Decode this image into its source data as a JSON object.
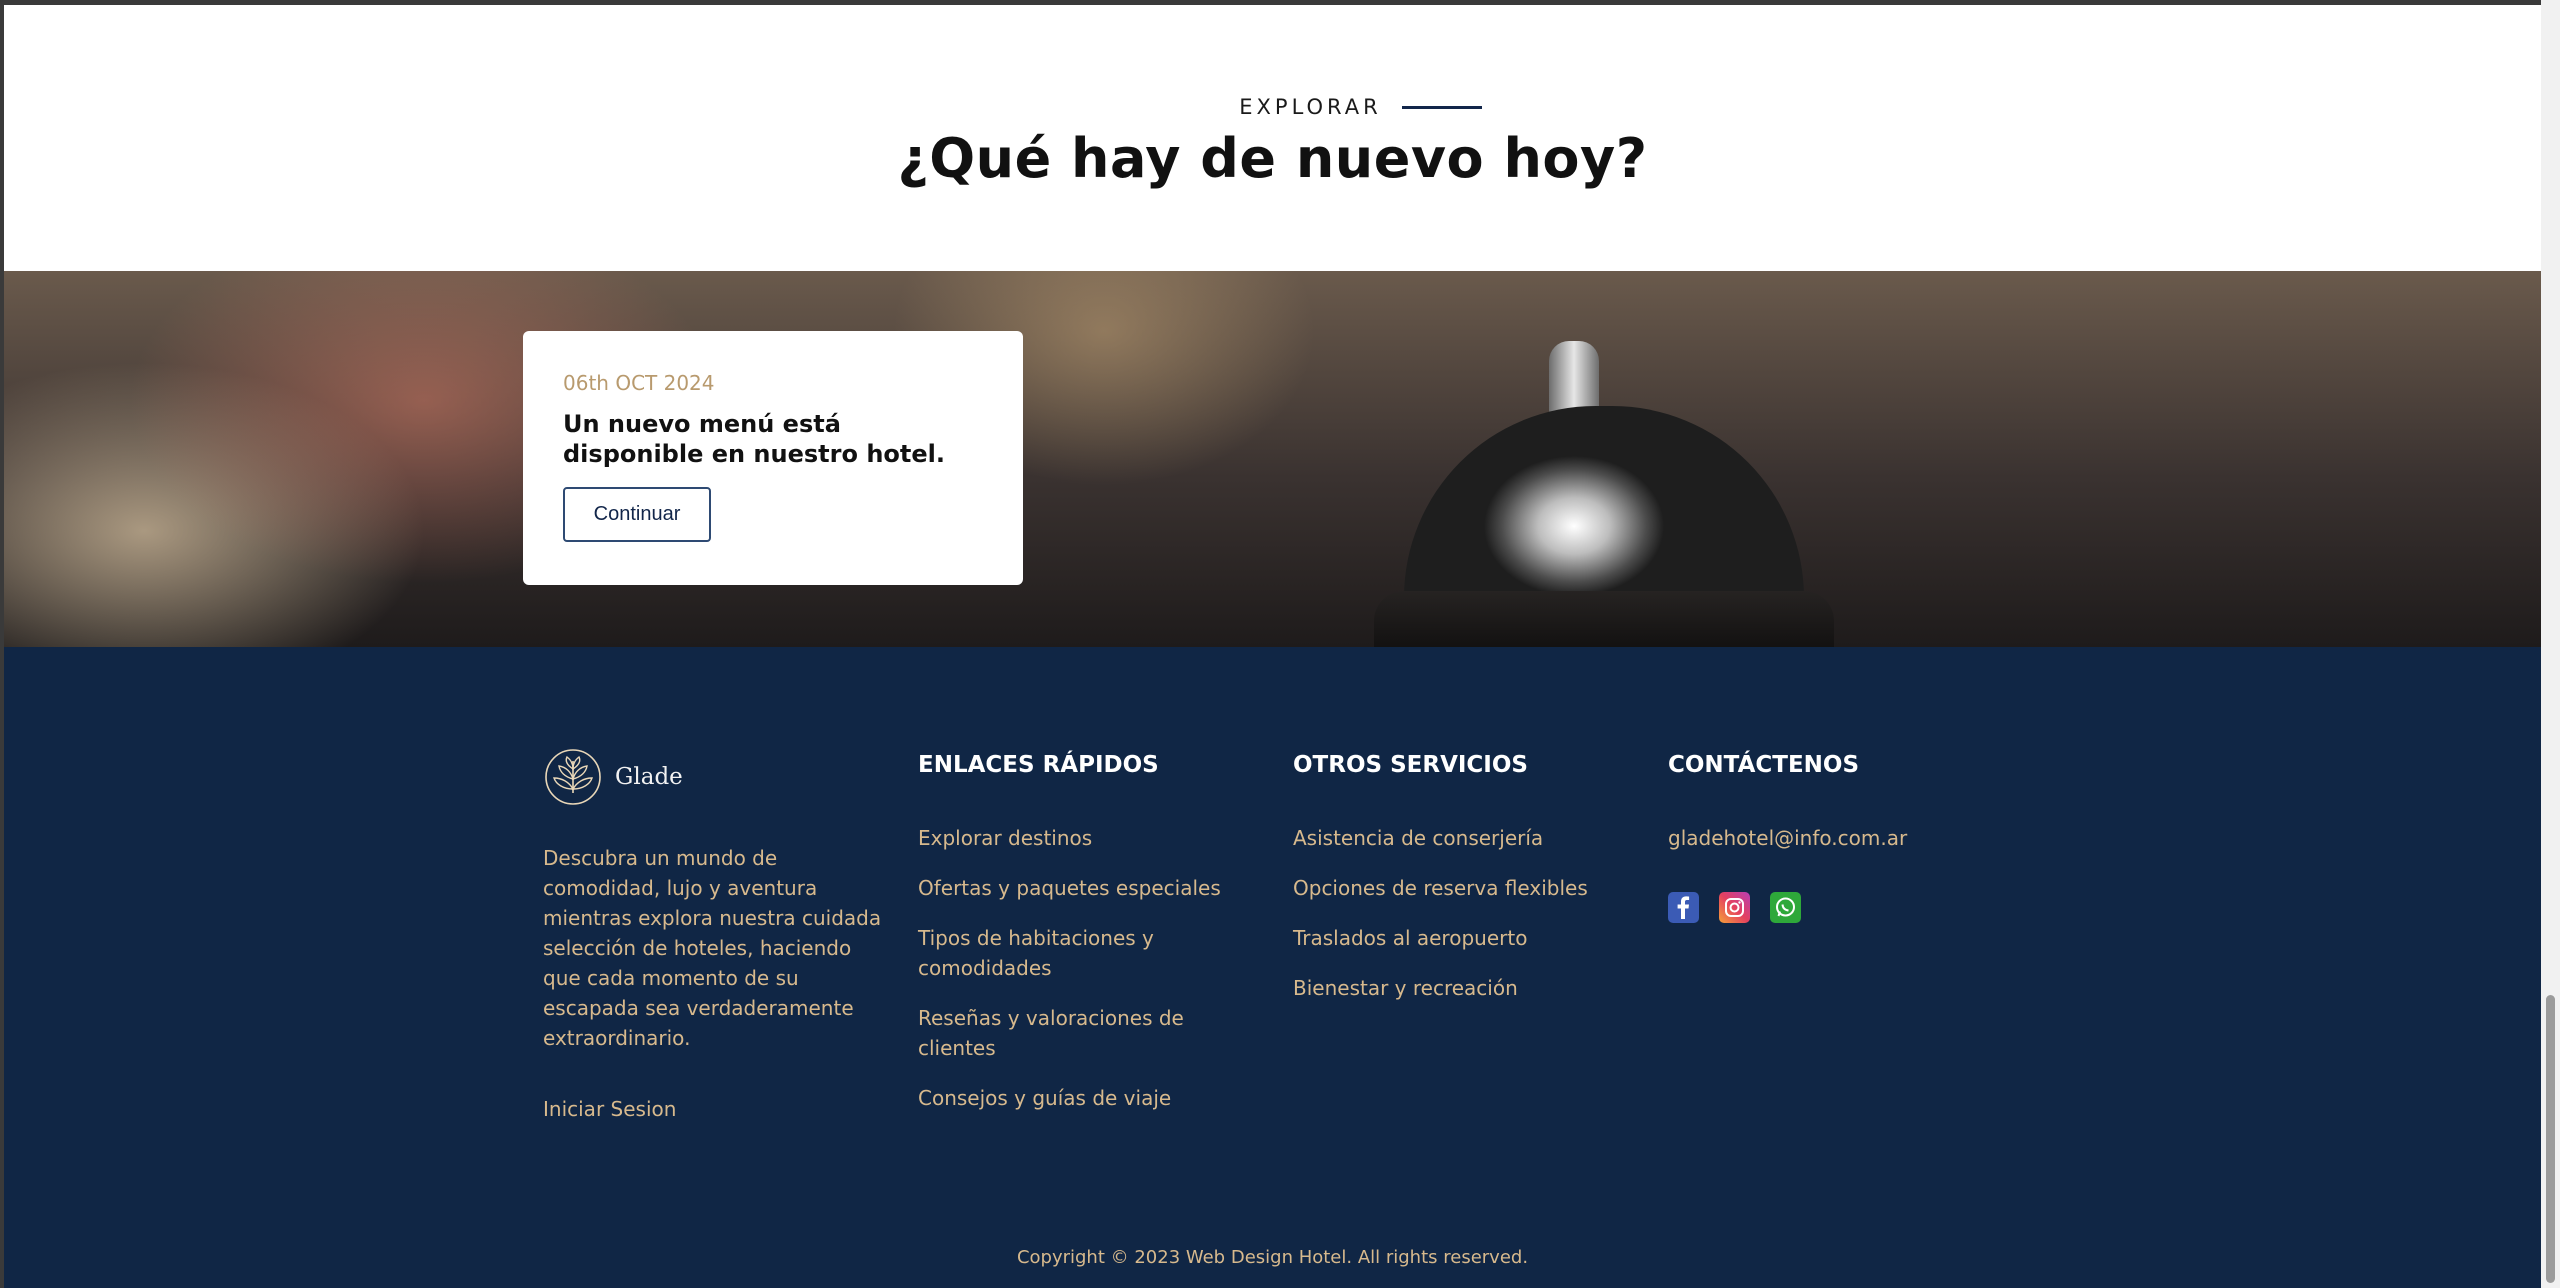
{
  "explore": {
    "eyebrow": "EXPLORAR",
    "headline": "¿Qué hay de nuevo hoy?"
  },
  "news": {
    "date": "06th OCT 2024",
    "title": "Un nuevo menú está disponible en nuestro hotel.",
    "button_label": "Continuar"
  },
  "footer": {
    "brand": {
      "name": "Glade",
      "description": "Descubra un mundo de comodidad, lujo y aventura mientras explora nuestra cuidada selección de hoteles, haciendo que cada momento de su escapada sea verdaderamente extraordinario.",
      "login_label": "Iniciar Sesion"
    },
    "quick_links": {
      "heading": "ENLACES RÁPIDOS",
      "items": [
        "Explorar destinos",
        "Ofertas y paquetes especiales",
        "Tipos de habitaciones y comodidades",
        "Reseñas y valoraciones de clientes",
        "Consejos y guías de viaje"
      ]
    },
    "services": {
      "heading": "OTROS SERVICIOS",
      "items": [
        "Asistencia de conserjería",
        "Opciones de reserva flexibles",
        "Traslados al aeropuerto",
        "Bienestar y recreación"
      ]
    },
    "contact": {
      "heading": "CONTÁCTENOS",
      "email": "gladehotel@info.com.ar",
      "socials": [
        "facebook-icon",
        "instagram-icon",
        "whatsapp-icon"
      ]
    },
    "copyright": "Copyright © 2023 Web Design Hotel. All rights reserved."
  },
  "colors": {
    "navy": "#102645",
    "gold": "#d7b98d",
    "accent_line": "#12264a"
  }
}
